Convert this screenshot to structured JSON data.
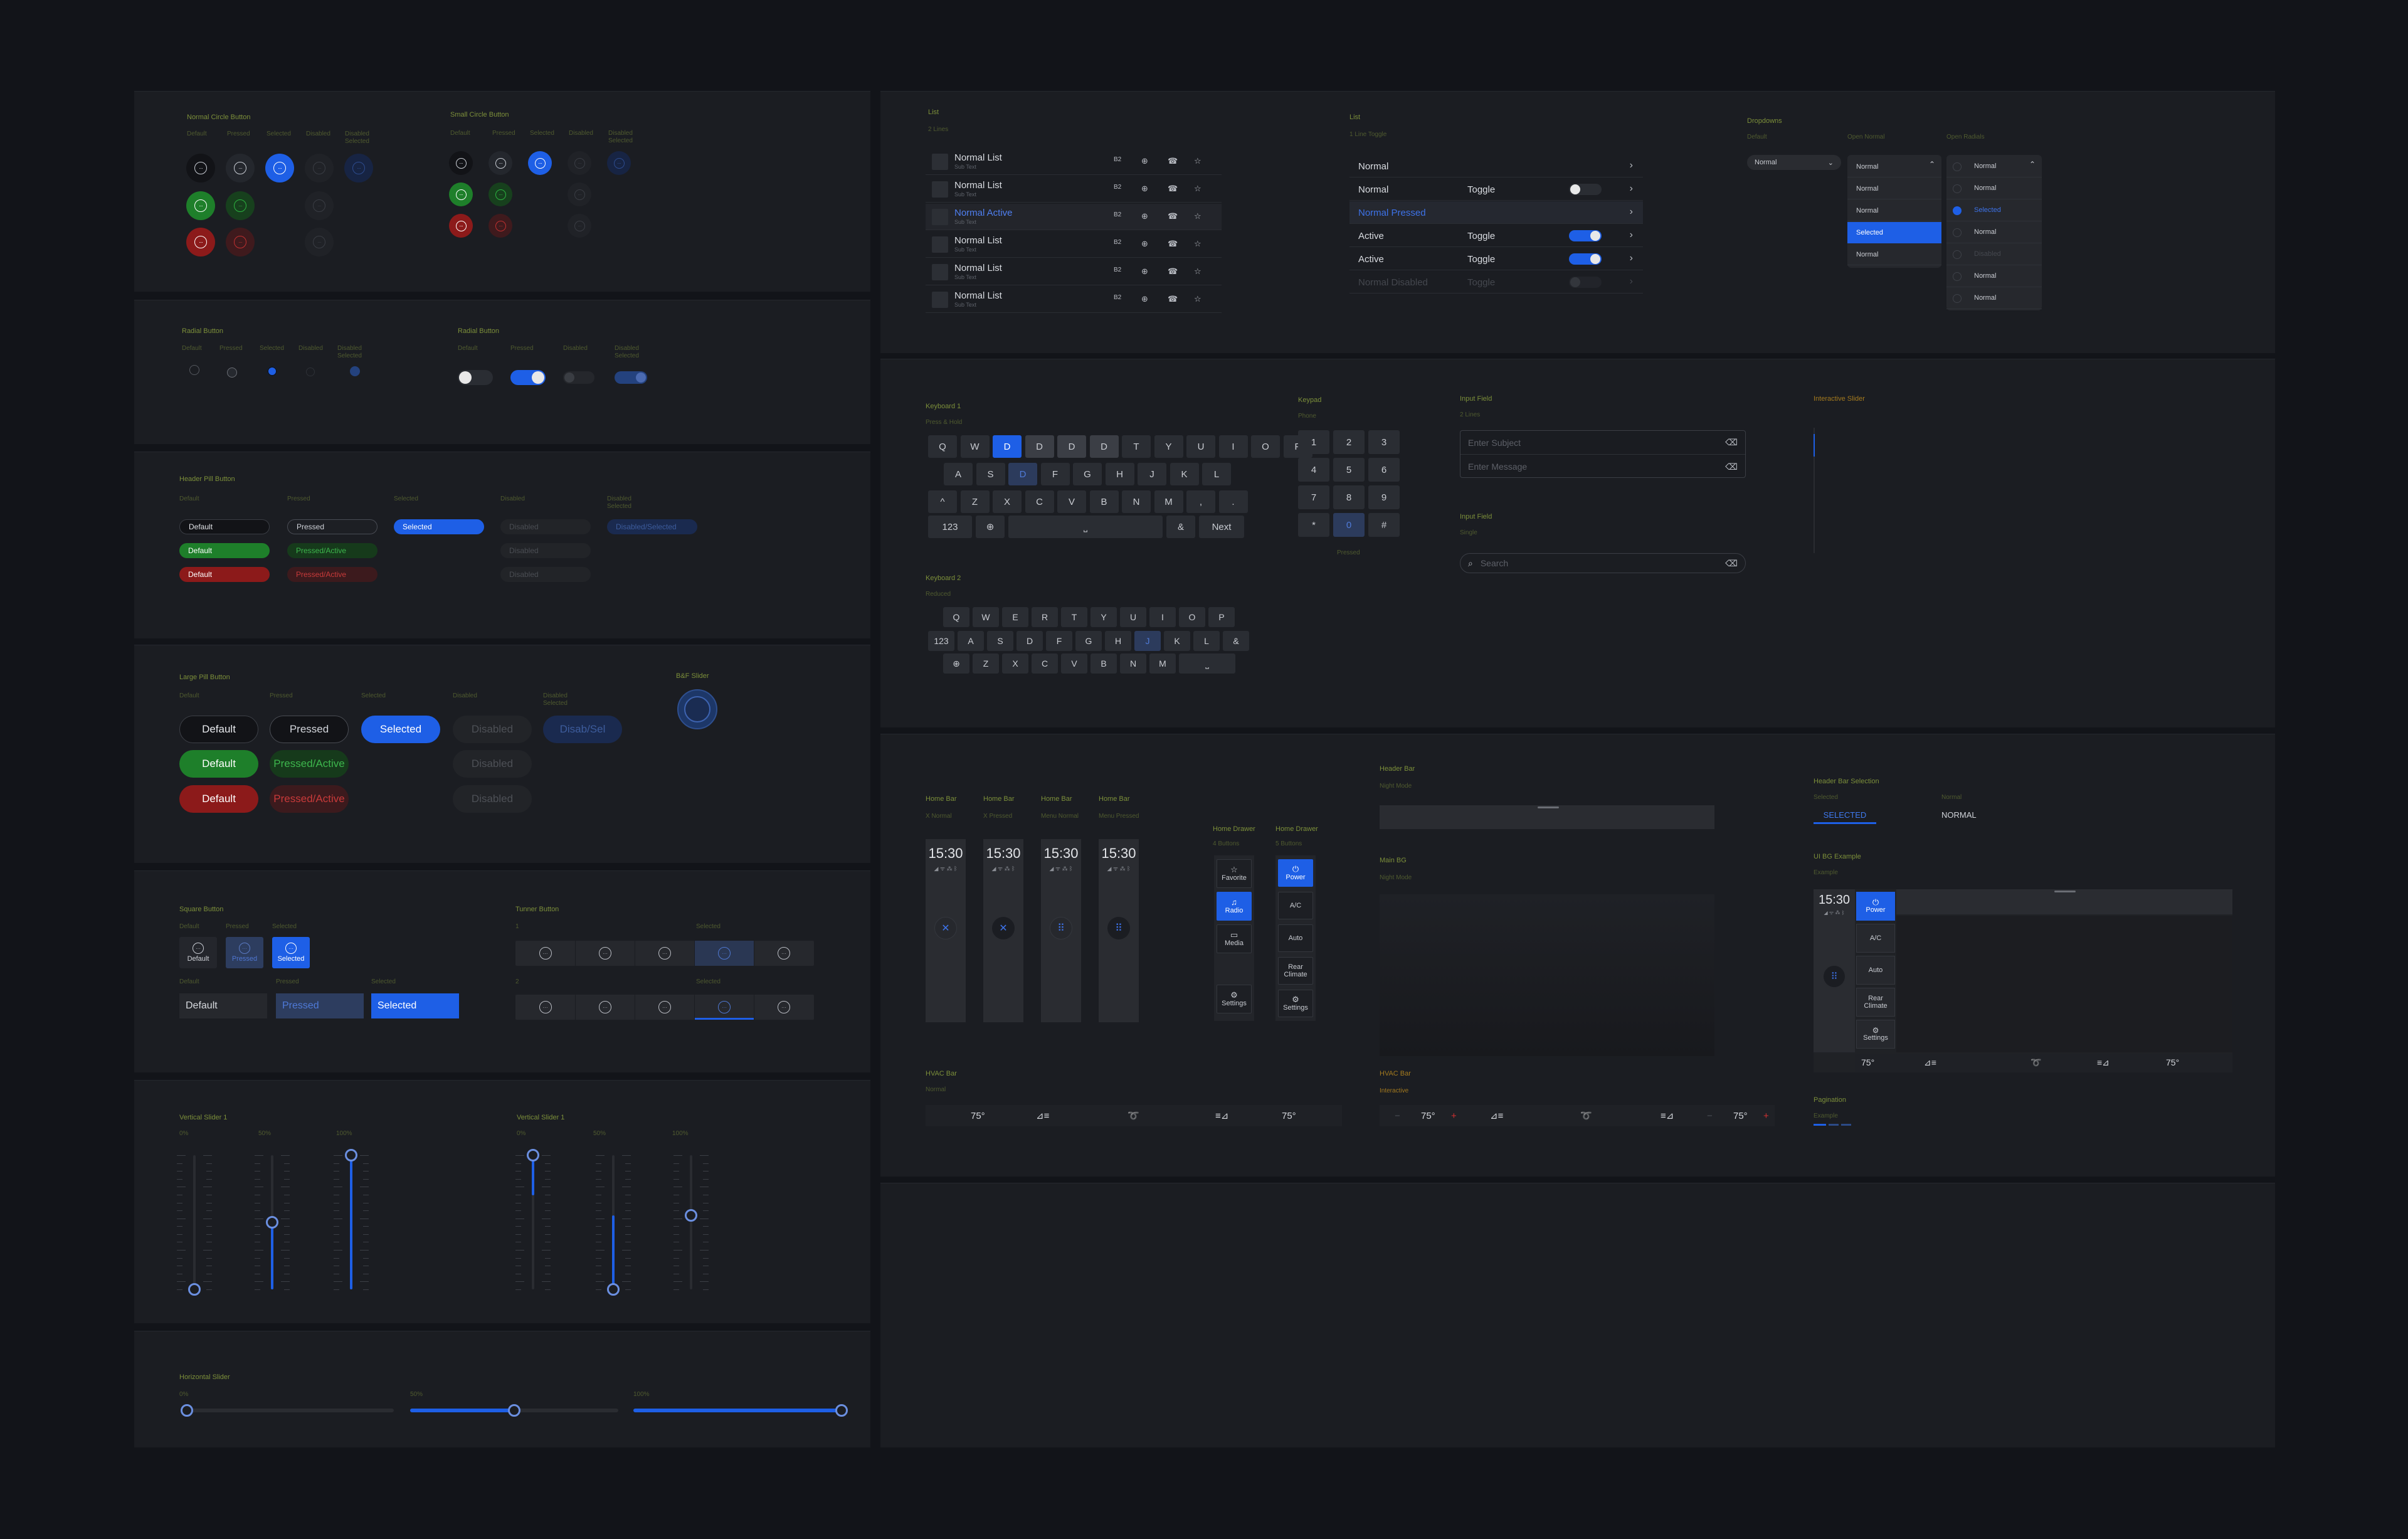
{
  "colors": {
    "bg": "#121419",
    "panel": "#1b1d22",
    "accent": "#1e5fe6",
    "green": "#1e7f2a",
    "red": "#8c1a1a",
    "label": "#7c8f3a"
  },
  "circle_normal": {
    "title": "Normal Circle Button",
    "states": [
      "Default",
      "Pressed",
      "Selected",
      "Disabled",
      "Disabled Selected"
    ]
  },
  "circle_small": {
    "title": "Small Circle Button",
    "states": [
      "Default",
      "Pressed",
      "Selected",
      "Disabled",
      "Disabled Selected"
    ]
  },
  "icon_glyph": "···",
  "radial_left": {
    "title": "Radial Button",
    "states": [
      "Default",
      "Pressed",
      "Selected",
      "Disabled",
      "Disabled Selected"
    ]
  },
  "radial_right": {
    "title": "Radial Button",
    "states": [
      "Default",
      "Pressed",
      "Disabled",
      "Disabled Selected"
    ]
  },
  "header_pill": {
    "title": "Header Pill Button",
    "states": [
      "Default",
      "Pressed",
      "Selected",
      "Disabled",
      "Disabled Selected"
    ],
    "labels": {
      "default": "Default",
      "pressed": "Pressed",
      "selected": "Selected",
      "disabled": "Disabled",
      "disabled_selected": "Disabled/Selected",
      "pressed_active": "Pressed/Active"
    }
  },
  "large_pill": {
    "title": "Large Pill Button",
    "states": [
      "Default",
      "Pressed",
      "Selected",
      "Disabled",
      "Disabled Selected"
    ],
    "labels": {
      "default": "Default",
      "pressed": "Pressed",
      "selected": "Selected",
      "disabled": "Disabled",
      "disabled_selected": "Disab/Sel",
      "pressed_active": "Pressed/Active"
    }
  },
  "bf_slider": {
    "title": "B&F Slider"
  },
  "square": {
    "title": "Square Button",
    "states": [
      "Default",
      "Pressed",
      "Selected"
    ],
    "labels": [
      "Default",
      "Pressed",
      "Selected"
    ]
  },
  "tuner": {
    "title": "Tunner Button",
    "row1": "1",
    "row2": "2",
    "selected": "Selected"
  },
  "vslider_a": {
    "title": "Vertical Slider 1",
    "levels": [
      "0%",
      "50%",
      "100%"
    ]
  },
  "vslider_b": {
    "title": "Vertical Slider 1",
    "levels": [
      "0%",
      "50%",
      "100%"
    ]
  },
  "hslider": {
    "title": "Horizontal Slider",
    "levels": [
      "0%",
      "50%",
      "100%"
    ]
  },
  "list2": {
    "title": "List",
    "subtitle": "2 Lines",
    "items": [
      {
        "title": "Normal List",
        "sub": "Sub Text",
        "active": false
      },
      {
        "title": "Normal List",
        "sub": "Sub Text",
        "active": false
      },
      {
        "title": "Normal Active",
        "sub": "Sub Text",
        "active": true
      },
      {
        "title": "Normal List",
        "sub": "Sub Text",
        "active": false
      },
      {
        "title": "Normal List",
        "sub": "Sub Text",
        "active": false
      },
      {
        "title": "Normal List",
        "sub": "Sub Text",
        "active": false
      }
    ],
    "icons": [
      "B2",
      "⊕",
      "☎",
      "☆"
    ]
  },
  "list1": {
    "title": "List",
    "subtitle": "1 Line Toggle",
    "rows": [
      {
        "label": "Normal",
        "toggle": "",
        "state": "none"
      },
      {
        "label": "Normal",
        "toggle": "Toggle",
        "state": "off"
      },
      {
        "label": "Normal Pressed",
        "toggle": "",
        "state": "pressed"
      },
      {
        "label": "Active",
        "toggle": "Toggle",
        "state": "on"
      },
      {
        "label": "Active",
        "toggle": "Toggle",
        "state": "on"
      },
      {
        "label": "Normal Disabled",
        "toggle": "Toggle",
        "state": "disabled"
      }
    ]
  },
  "dropdowns": {
    "title": "Dropdowns",
    "col_default": "Default",
    "col_open": "Open Normal",
    "col_radials": "Open Radials",
    "value": "Normal",
    "open_items": [
      "Normal",
      "Normal",
      "Normal",
      "Selected",
      "Normal"
    ],
    "radial_items": [
      "Normal",
      "Normal",
      "Selected",
      "Normal",
      "Disabled",
      "Normal",
      "Normal"
    ]
  },
  "keyboard1": {
    "title": "Keyboard 1",
    "subtitle": "Press & Hold",
    "row1": [
      "Q",
      "W",
      "D",
      "D",
      "D",
      "D",
      "T",
      "Y",
      "U",
      "I",
      "O",
      "P"
    ],
    "row2": [
      "A",
      "S",
      "D",
      "F",
      "G",
      "H",
      "J",
      "K",
      "L"
    ],
    "row3": [
      "^",
      "Z",
      "X",
      "C",
      "V",
      "B",
      "N",
      "M",
      ",",
      "."
    ],
    "row4": [
      "123",
      "⊕",
      "⎵",
      "&",
      "Next"
    ]
  },
  "keyboard2": {
    "title": "Keyboard 2",
    "subtitle": "Reduced",
    "row1": [
      "Q",
      "W",
      "E",
      "R",
      "T",
      "Y",
      "U",
      "I",
      "O",
      "P"
    ],
    "row2": [
      "123",
      "A",
      "S",
      "D",
      "F",
      "G",
      "H",
      "J",
      "K",
      "L",
      "&"
    ],
    "row3": [
      "⊕",
      "Z",
      "X",
      "C",
      "V",
      "B",
      "N",
      "M",
      "⎵"
    ]
  },
  "keypad": {
    "title": "Keypad",
    "subtitle": "Phone",
    "keys": [
      "1",
      "2",
      "3",
      "4",
      "5",
      "6",
      "7",
      "8",
      "9",
      "*",
      "0",
      "#"
    ],
    "pressed_label": "Pressed"
  },
  "input1": {
    "title": "Input Field",
    "subtitle": "2 Lines",
    "ph1": "Enter Subject",
    "ph2": "Enter Message"
  },
  "input2": {
    "title": "Input Field",
    "subtitle": "Single",
    "ph": "Search"
  },
  "islider": {
    "title": "Interactive Slider"
  },
  "homebars": [
    {
      "title": "Home Bar",
      "sub": "X Normal",
      "time": "15:30",
      "icon": "✕"
    },
    {
      "title": "Home Bar",
      "sub": "X Pressed",
      "time": "15:30",
      "icon": "✕"
    },
    {
      "title": "Home Bar",
      "sub": "Menu Normal",
      "time": "15:30",
      "icon": "⠿"
    },
    {
      "title": "Home Bar",
      "sub": "Menu Pressed",
      "time": "15:30",
      "icon": "⠿"
    }
  ],
  "drawer4": {
    "title": "Home Drawer",
    "sub": "4 Buttons",
    "items": [
      {
        "icon": "☆",
        "label": "Favorite",
        "sel": false
      },
      {
        "icon": "♫",
        "label": "Radio",
        "sel": true
      },
      {
        "icon": "▭",
        "label": "Media",
        "sel": false
      },
      {
        "icon": "⚙",
        "label": "Settings",
        "sel": false
      }
    ]
  },
  "drawer5": {
    "title": "Home Drawer",
    "sub": "5 Buttons",
    "items": [
      {
        "icon": "⏻",
        "label": "Power",
        "sel": true
      },
      {
        "icon": "",
        "label": "A/C",
        "sel": false
      },
      {
        "icon": "",
        "label": "Auto",
        "sel": false
      },
      {
        "icon": "",
        "label": "Rear Climate",
        "sel": false
      },
      {
        "icon": "⚙",
        "label": "Settings",
        "sel": false
      }
    ]
  },
  "headerbar": {
    "title": "Header Bar",
    "sub": "Night Mode"
  },
  "mainbg": {
    "title": "Main BG",
    "sub": "Night Mode"
  },
  "hvac1": {
    "title": "HVAC Bar",
    "sub": "Normal",
    "temp_l": "75°",
    "temp_r": "75°"
  },
  "hvac2": {
    "title": "HVAC Bar",
    "sub": "Interactive",
    "temp_l": "75°",
    "temp_r": "75°"
  },
  "headersel": {
    "title": "Header Bar Selection",
    "sub_sel": "Selected",
    "sub_norm": "Normal",
    "sel": "SELECTED",
    "norm": "NORMAL"
  },
  "uibg": {
    "title": "UI BG Example",
    "sub": "Example",
    "time": "15:30",
    "items": [
      "Power",
      "A/C",
      "Auto",
      "Rear Climate",
      "Settings"
    ],
    "temp_l": "75°",
    "temp_r": "75°"
  },
  "pagination": {
    "title": "Pagination",
    "sub": "Example"
  }
}
